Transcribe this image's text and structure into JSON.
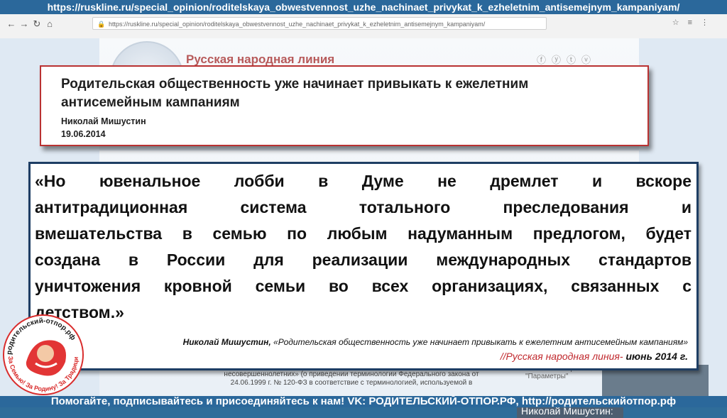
{
  "top_banner": "https://ruskline.ru/special_opinion/roditelskaya_obwestvennost_uzhe_nachinaet_privykat_k_ezheletnim_antisemejnym_kampaniyam/",
  "browser": {
    "url": "https://ruskline.ru/special_opinion/roditelskaya_obwestvennost_uzhe_nachinaet_privykat_k_ezheletnim_antisemejnym_kampaniyam/"
  },
  "site": {
    "title": "Русская народная линия",
    "below_text": "основах системы профилактики безнадзорности и правонарушений несовершеннолетних» (о приведении терминологии Федерального закона от 24.06.1999 г. № 120-ФЗ в соответствие с терминологией, используемой в",
    "right_small": "Чтобы активировать Windows, перейдите в раздел \"Параметры\"",
    "author_box": "Николай Мишустин:"
  },
  "headline": {
    "title": "Родительская общественность уже начинает привыкать к ежелетним антисемейным кампаниям",
    "author": "Николай Мишустин",
    "date": "19.06.2014"
  },
  "quote": {
    "lines": [
      "«Но ювенальное лобби в Думе не дремлет и вскоре",
      "антитрадиционная система тотального преследования и",
      "вмешательства в семью по любым надуманным предлогом, будет",
      "создана в России для реализации международных стандартов",
      "уничтожения кровной семьи во всех организациях, связанных с",
      "детством.»"
    ],
    "cite_author": "Николай Мишустин,",
    "cite_title": "«Родительская общественность уже начинает привыкать к ежелетним антисемейным кампаниям»",
    "source_prefix": "//Русская народная линия-",
    "source_date": "июнь 2014 г."
  },
  "stamp": {
    "top": "родительский-отпор.рф",
    "bottom": "За Семью! За Родину! За Традиции!"
  },
  "bottom_bar": "Помогайте, подписывайтесь и присоединяйтесь к нам! VK: РОДИТЕЛЬСКИЙ-ОТПОР.РФ, http://родительскийотпор.рф"
}
